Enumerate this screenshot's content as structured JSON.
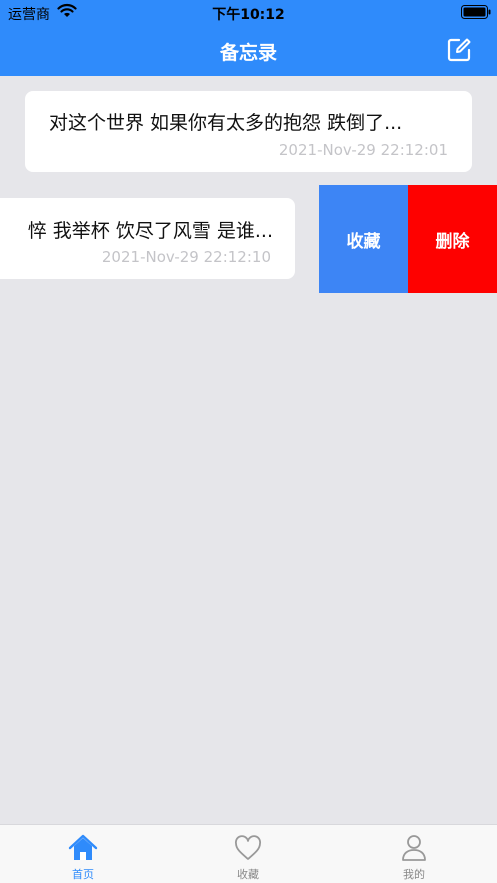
{
  "status_bar": {
    "carrier": "运营商",
    "time": "下午10:12"
  },
  "header": {
    "title": "备忘录",
    "compose_icon": "compose-icon"
  },
  "notes": [
    {
      "text": "对这个世界 如果你有太多的抱怨 跌倒了...",
      "date": "2021-Nov-29 22:12:01"
    },
    {
      "text": "悴 我举杯 饮尽了风雪 是谁...",
      "date": "2021-Nov-29 22:12:10"
    }
  ],
  "swipe_actions": {
    "favorite": "收藏",
    "delete": "删除"
  },
  "tabbar": {
    "items": [
      {
        "label": "首页",
        "icon": "home-icon",
        "active": true
      },
      {
        "label": "收藏",
        "icon": "heart-icon",
        "active": false
      },
      {
        "label": "我的",
        "icon": "user-icon",
        "active": false
      }
    ]
  },
  "colors": {
    "accent": "#2f8bfb",
    "favorite": "#3d85f5",
    "delete": "#fe0100",
    "background": "#e6e6ea"
  }
}
